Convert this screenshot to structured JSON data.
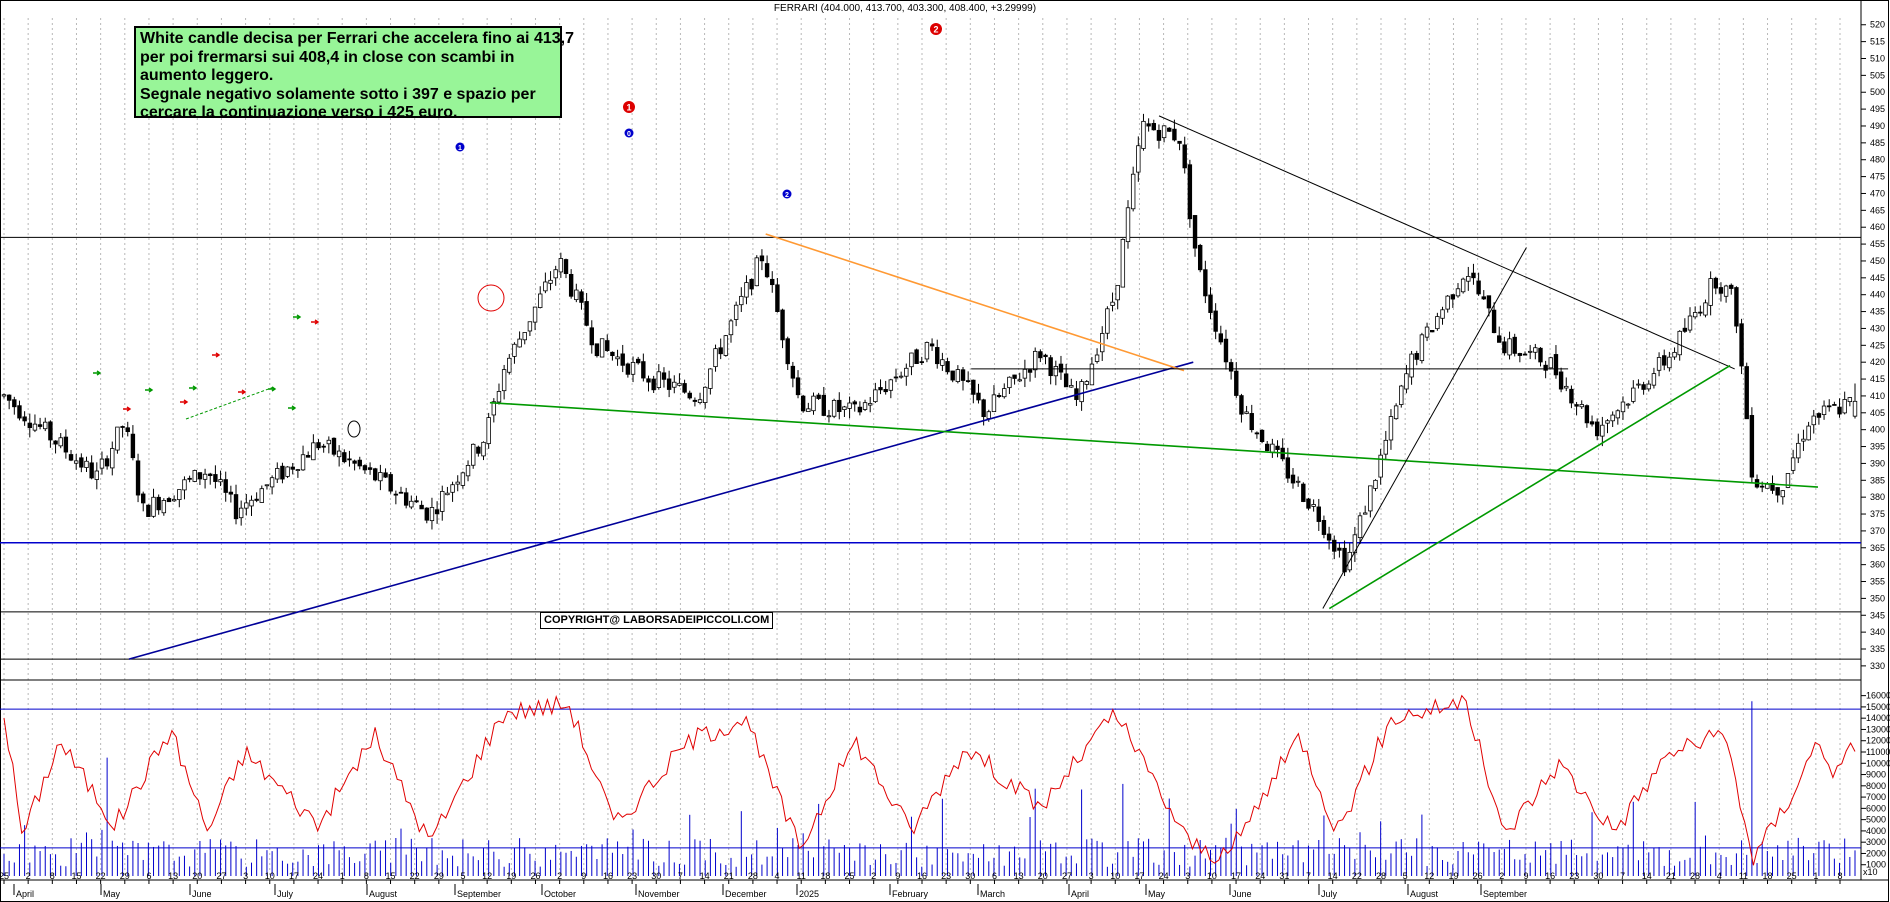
{
  "note": {
    "lines": [
      "White candle decisa per Ferrari che accelera fino ai 413,7",
      "per poi frermarsi sui 408,4 in close con scambi in",
      "aumento leggero.",
      "Segnale negativo solamente sotto i 397 e spazio per",
      "cercare la continuazione verso i 425 euro."
    ]
  },
  "copyright": "COPYRIGHT@ LABORSADEIPICCOLI.COM",
  "chart_data": [
    {
      "type": "candlestick",
      "title": "FERRARI (404.000, 413.700, 403.300, 408.400, +3.29999)",
      "ylim": [
        327,
        522
      ],
      "yticks": [
        330,
        335,
        340,
        345,
        350,
        355,
        360,
        365,
        370,
        375,
        380,
        385,
        390,
        395,
        400,
        405,
        410,
        415,
        420,
        425,
        430,
        435,
        440,
        445,
        450,
        455,
        460,
        465,
        470,
        475,
        480,
        485,
        490,
        495,
        500,
        505,
        510,
        515,
        520
      ],
      "grid": true,
      "horizontal_levels": [
        {
          "value": 457,
          "color": "#000000"
        },
        {
          "value": 366.5,
          "color": "#0000cc"
        },
        {
          "value": 346,
          "color": "#000000"
        },
        {
          "value": 332,
          "color": "#000000"
        }
      ],
      "x_labels": [
        {
          "text": "25",
          "row": 1
        },
        {
          "text": "2",
          "row": 1
        },
        {
          "text": "8",
          "row": 1
        },
        {
          "text": "15",
          "row": 1
        },
        {
          "text": "22",
          "row": 1
        },
        {
          "text": "29",
          "row": 1
        },
        {
          "text": "6",
          "row": 1
        },
        {
          "text": "13",
          "row": 1
        },
        {
          "text": "20",
          "row": 1
        },
        {
          "text": "27",
          "row": 1
        },
        {
          "text": "3",
          "row": 1
        },
        {
          "text": "10",
          "row": 1
        },
        {
          "text": "17",
          "row": 1
        },
        {
          "text": "24",
          "row": 1
        },
        {
          "text": "1",
          "row": 1
        },
        {
          "text": "8",
          "row": 1
        },
        {
          "text": "15",
          "row": 1
        },
        {
          "text": "22",
          "row": 1
        },
        {
          "text": "29",
          "row": 1
        },
        {
          "text": "5",
          "row": 1
        },
        {
          "text": "12",
          "row": 1
        },
        {
          "text": "19",
          "row": 1
        },
        {
          "text": "26",
          "row": 1
        },
        {
          "text": "2",
          "row": 1
        },
        {
          "text": "9",
          "row": 1
        },
        {
          "text": "16",
          "row": 1
        },
        {
          "text": "23",
          "row": 1
        },
        {
          "text": "30",
          "row": 1
        },
        {
          "text": "7",
          "row": 1
        },
        {
          "text": "14",
          "row": 1
        },
        {
          "text": "21",
          "row": 1
        },
        {
          "text": "28",
          "row": 1
        },
        {
          "text": "4",
          "row": 1
        },
        {
          "text": "11",
          "row": 1
        },
        {
          "text": "18",
          "row": 1
        },
        {
          "text": "25",
          "row": 1
        },
        {
          "text": "2",
          "row": 1
        },
        {
          "text": "9",
          "row": 1
        },
        {
          "text": "16",
          "row": 1
        },
        {
          "text": "23",
          "row": 1
        },
        {
          "text": "30",
          "row": 1
        },
        {
          "text": "6",
          "row": 1
        },
        {
          "text": "13",
          "row": 1
        },
        {
          "text": "20",
          "row": 1
        },
        {
          "text": "27",
          "row": 1
        },
        {
          "text": "3",
          "row": 1
        },
        {
          "text": "10",
          "row": 1
        },
        {
          "text": "17",
          "row": 1
        },
        {
          "text": "24",
          "row": 1
        },
        {
          "text": "3",
          "row": 1
        },
        {
          "text": "10",
          "row": 1
        },
        {
          "text": "17",
          "row": 1
        },
        {
          "text": "24",
          "row": 1
        },
        {
          "text": "31",
          "row": 1
        },
        {
          "text": "7",
          "row": 1
        },
        {
          "text": "14",
          "row": 1
        },
        {
          "text": "22",
          "row": 1
        },
        {
          "text": "28",
          "row": 1
        },
        {
          "text": "5",
          "row": 1
        },
        {
          "text": "12",
          "row": 1
        },
        {
          "text": "19",
          "row": 1
        },
        {
          "text": "26",
          "row": 1
        },
        {
          "text": "2",
          "row": 1
        },
        {
          "text": "9",
          "row": 1
        },
        {
          "text": "16",
          "row": 1
        },
        {
          "text": "23",
          "row": 1
        },
        {
          "text": "30",
          "row": 1
        },
        {
          "text": "7",
          "row": 1
        },
        {
          "text": "14",
          "row": 1
        },
        {
          "text": "21",
          "row": 1
        },
        {
          "text": "28",
          "row": 1
        },
        {
          "text": "4",
          "row": 1
        },
        {
          "text": "11",
          "row": 1
        },
        {
          "text": "18",
          "row": 1
        },
        {
          "text": "25",
          "row": 1
        },
        {
          "text": "1",
          "row": 1
        },
        {
          "text": "8",
          "row": 1
        }
      ],
      "month_labels": [
        "April",
        "May",
        "June",
        "July",
        "August",
        "September",
        "October",
        "November",
        "December",
        "2025",
        "February",
        "March",
        "April",
        "May",
        "June",
        "July",
        "August",
        "September"
      ],
      "annotations": [
        {
          "text": "1",
          "color": "#0000cc"
        },
        {
          "text": "1",
          "color": "#dd0000"
        },
        {
          "text": "0",
          "color": "#0000cc"
        },
        {
          "text": "2",
          "color": "#0000cc"
        },
        {
          "text": "2",
          "color": "#dd0000"
        }
      ],
      "last_candle": {
        "open": 404.0,
        "high": 413.7,
        "low": 403.3,
        "close": 408.4,
        "change": 3.29999
      },
      "keypoints": [
        {
          "x": 0,
          "price": 410
        },
        {
          "x": 0.05,
          "price": 386
        },
        {
          "x": 0.065,
          "price": 402
        },
        {
          "x": 0.075,
          "price": 376
        },
        {
          "x": 0.11,
          "price": 388
        },
        {
          "x": 0.125,
          "price": 376
        },
        {
          "x": 0.17,
          "price": 396
        },
        {
          "x": 0.2,
          "price": 386
        },
        {
          "x": 0.23,
          "price": 375
        },
        {
          "x": 0.26,
          "price": 398
        },
        {
          "x": 0.27,
          "price": 418
        },
        {
          "x": 0.3,
          "price": 450
        },
        {
          "x": 0.32,
          "price": 425
        },
        {
          "x": 0.35,
          "price": 415
        },
        {
          "x": 0.375,
          "price": 410
        },
        {
          "x": 0.41,
          "price": 452
        },
        {
          "x": 0.43,
          "price": 408
        },
        {
          "x": 0.46,
          "price": 405
        },
        {
          "x": 0.5,
          "price": 425
        },
        {
          "x": 0.52,
          "price": 412
        },
        {
          "x": 0.53,
          "price": 405
        },
        {
          "x": 0.56,
          "price": 423
        },
        {
          "x": 0.58,
          "price": 408
        },
        {
          "x": 0.6,
          "price": 440
        },
        {
          "x": 0.615,
          "price": 490
        },
        {
          "x": 0.635,
          "price": 487
        },
        {
          "x": 0.645,
          "price": 448
        },
        {
          "x": 0.67,
          "price": 405
        },
        {
          "x": 0.71,
          "price": 375
        },
        {
          "x": 0.725,
          "price": 360
        },
        {
          "x": 0.74,
          "price": 385
        },
        {
          "x": 0.76,
          "price": 420
        },
        {
          "x": 0.79,
          "price": 448
        },
        {
          "x": 0.81,
          "price": 425
        },
        {
          "x": 0.835,
          "price": 420
        },
        {
          "x": 0.86,
          "price": 400
        },
        {
          "x": 0.9,
          "price": 422
        },
        {
          "x": 0.925,
          "price": 445
        },
        {
          "x": 0.935,
          "price": 438
        },
        {
          "x": 0.945,
          "price": 385
        },
        {
          "x": 0.96,
          "price": 383
        },
        {
          "x": 0.975,
          "price": 403
        },
        {
          "x": 1.0,
          "price": 408.4
        }
      ],
      "trendlines": [
        {
          "from": {
            "x": 0.0675,
            "price": 332
          },
          "to": {
            "x": 0.6425,
            "price": 420
          },
          "color": "#000099"
        },
        {
          "from": {
            "x": 0.2625,
            "price": 408
          },
          "to": {
            "x": 0.98,
            "price": 383
          },
          "color": "#009900"
        },
        {
          "from": {
            "x": 0.4115,
            "price": 458
          },
          "to": {
            "x": 0.6375,
            "price": 417.5
          },
          "color": "#ff9933"
        },
        {
          "from": {
            "x": 0.5225,
            "price": 418
          },
          "to": {
            "x": 0.845,
            "price": 418
          },
          "color": "#000000"
        },
        {
          "from": {
            "x": 0.624,
            "price": 493
          },
          "to": {
            "x": 0.935,
            "price": 418
          },
          "color": "#000000"
        },
        {
          "from": {
            "x": 0.716,
            "price": 347
          },
          "to": {
            "x": 0.9325,
            "price": 419
          },
          "color": "#009900"
        },
        {
          "from": {
            "x": 0.7125,
            "price": 347
          },
          "to": {
            "x": 0.8225,
            "price": 454
          },
          "color": "#000000"
        }
      ]
    },
    {
      "type": "volume-oscillator",
      "ylim": [
        0,
        16500
      ],
      "yticks": [
        1000,
        2000,
        3000,
        4000,
        5000,
        6000,
        7000,
        8000,
        9000,
        10000,
        11000,
        12000,
        13000,
        14000,
        15000,
        16000
      ],
      "unit_label": "x10",
      "horizontal_levels": [
        14800,
        2500
      ],
      "oscillator_keypoints": [
        {
          "x": 0,
          "value": 14500
        },
        {
          "x": 0.01,
          "value": 3500
        },
        {
          "x": 0.03,
          "value": 12000
        },
        {
          "x": 0.06,
          "value": 4500
        },
        {
          "x": 0.09,
          "value": 13000
        },
        {
          "x": 0.11,
          "value": 4000
        },
        {
          "x": 0.13,
          "value": 11000
        },
        {
          "x": 0.17,
          "value": 4500
        },
        {
          "x": 0.2,
          "value": 12500
        },
        {
          "x": 0.23,
          "value": 3000
        },
        {
          "x": 0.27,
          "value": 14500
        },
        {
          "x": 0.305,
          "value": 15300
        },
        {
          "x": 0.33,
          "value": 4500
        },
        {
          "x": 0.37,
          "value": 12000
        },
        {
          "x": 0.4,
          "value": 14000
        },
        {
          "x": 0.43,
          "value": 2500
        },
        {
          "x": 0.46,
          "value": 12000
        },
        {
          "x": 0.49,
          "value": 4000
        },
        {
          "x": 0.52,
          "value": 11500
        },
        {
          "x": 0.56,
          "value": 6000
        },
        {
          "x": 0.6,
          "value": 14500
        },
        {
          "x": 0.64,
          "value": 3000
        },
        {
          "x": 0.66,
          "value": 1500
        },
        {
          "x": 0.7,
          "value": 12500
        },
        {
          "x": 0.72,
          "value": 4000
        },
        {
          "x": 0.75,
          "value": 14000
        },
        {
          "x": 0.79,
          "value": 15500
        },
        {
          "x": 0.81,
          "value": 3500
        },
        {
          "x": 0.84,
          "value": 10000
        },
        {
          "x": 0.87,
          "value": 4000
        },
        {
          "x": 0.9,
          "value": 11000
        },
        {
          "x": 0.93,
          "value": 12500
        },
        {
          "x": 0.945,
          "value": 1500
        },
        {
          "x": 0.965,
          "value": 7000
        },
        {
          "x": 0.98,
          "value": 12000
        },
        {
          "x": 0.99,
          "value": 9000
        },
        {
          "x": 1.0,
          "value": 11800
        }
      ]
    }
  ]
}
